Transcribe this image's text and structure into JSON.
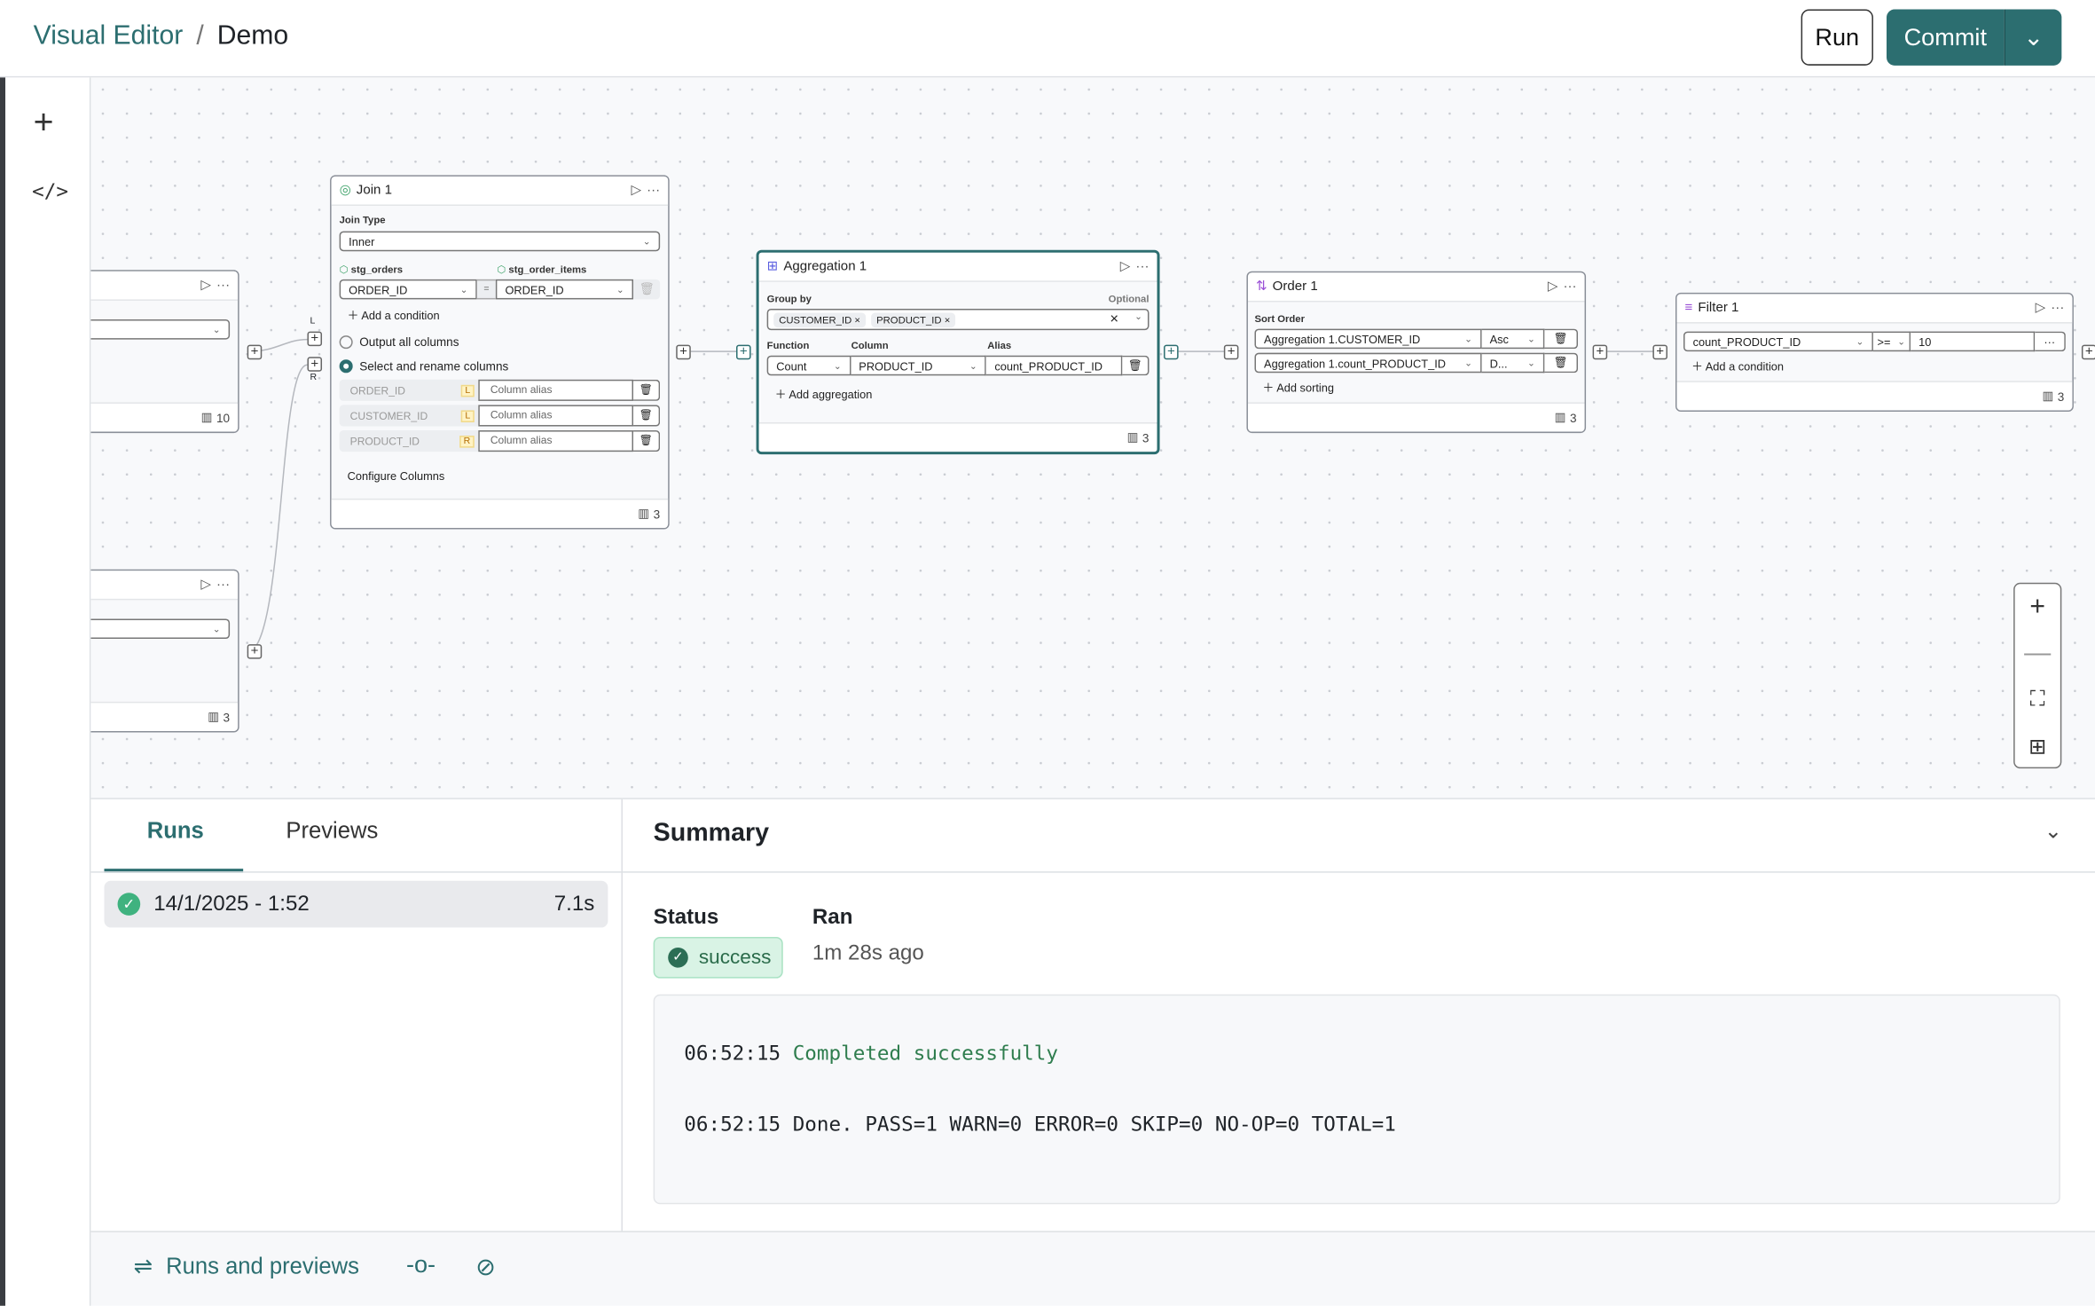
{
  "header": {
    "title": "Visual Editor",
    "separator": "/",
    "page": "Demo",
    "run_label": "Run",
    "commit_label": "Commit"
  },
  "colors": {
    "accent": "#2c6e70",
    "success": "#3fb27f",
    "success_bg": "#d9f3e5",
    "log_green": "#2f7d4e"
  },
  "rail": {
    "icons": [
      "plus-icon",
      "code-icon"
    ]
  },
  "nodes": {
    "source1": {
      "rows": "10"
    },
    "source2": {
      "rows": "3"
    },
    "join": {
      "title": "Join 1",
      "join_type_label": "Join Type",
      "join_type": "Inner",
      "left_table": "stg_orders",
      "right_table": "stg_order_items",
      "left_col": "ORDER_ID",
      "eq": "=",
      "right_col": "ORDER_ID",
      "add_condition": "Add a condition",
      "opt_all": "Output all columns",
      "opt_select": "Select and rename columns",
      "columns": [
        {
          "name": "ORDER_ID",
          "side": "L",
          "alias_placeholder": "Column alias"
        },
        {
          "name": "CUSTOMER_ID",
          "side": "L",
          "alias_placeholder": "Column alias"
        },
        {
          "name": "PRODUCT_ID",
          "side": "R",
          "alias_placeholder": "Column alias"
        }
      ],
      "configure": "Configure Columns",
      "rows": "3",
      "handle_l": "L",
      "handle_r": "R"
    },
    "aggregation": {
      "title": "Aggregation 1",
      "group_by_label": "Group by",
      "optional": "Optional",
      "group_by": [
        "CUSTOMER_ID",
        "PRODUCT_ID"
      ],
      "function_label": "Function",
      "column_label": "Column",
      "alias_label": "Alias",
      "function": "Count",
      "column": "PRODUCT_ID",
      "alias": "count_PRODUCT_ID",
      "add": "Add aggregation",
      "rows": "3"
    },
    "order": {
      "title": "Order 1",
      "sort_label": "Sort Order",
      "sorts": [
        {
          "column": "Aggregation 1.CUSTOMER_ID",
          "dir": "Asc"
        },
        {
          "column": "Aggregation 1.count_PRODUCT_ID",
          "dir": "D..."
        }
      ],
      "add": "Add sorting",
      "rows": "3"
    },
    "filter": {
      "title": "Filter 1",
      "column": "count_PRODUCT_ID",
      "op": ">=",
      "value": "10",
      "add": "Add a condition",
      "rows": "3"
    }
  },
  "bottom": {
    "tabs": [
      {
        "label": "Runs",
        "active": true
      },
      {
        "label": "Previews",
        "active": false
      }
    ],
    "runs": [
      {
        "date": "14/1/2025 - 1:52",
        "duration": "7.1s",
        "status": "success"
      }
    ],
    "summary": {
      "title": "Summary",
      "status_label": "Status",
      "status": "success",
      "ran_label": "Ran",
      "ran": "1m 28s ago",
      "log": [
        {
          "time": "06:52:15",
          "msg": "Completed successfully"
        },
        {
          "time": "06:52:15",
          "msg": "Done. PASS=1 WARN=0 ERROR=0 SKIP=0 NO-OP=0 TOTAL=1"
        }
      ]
    }
  },
  "footer": {
    "runs_previews": "Runs and previews"
  }
}
